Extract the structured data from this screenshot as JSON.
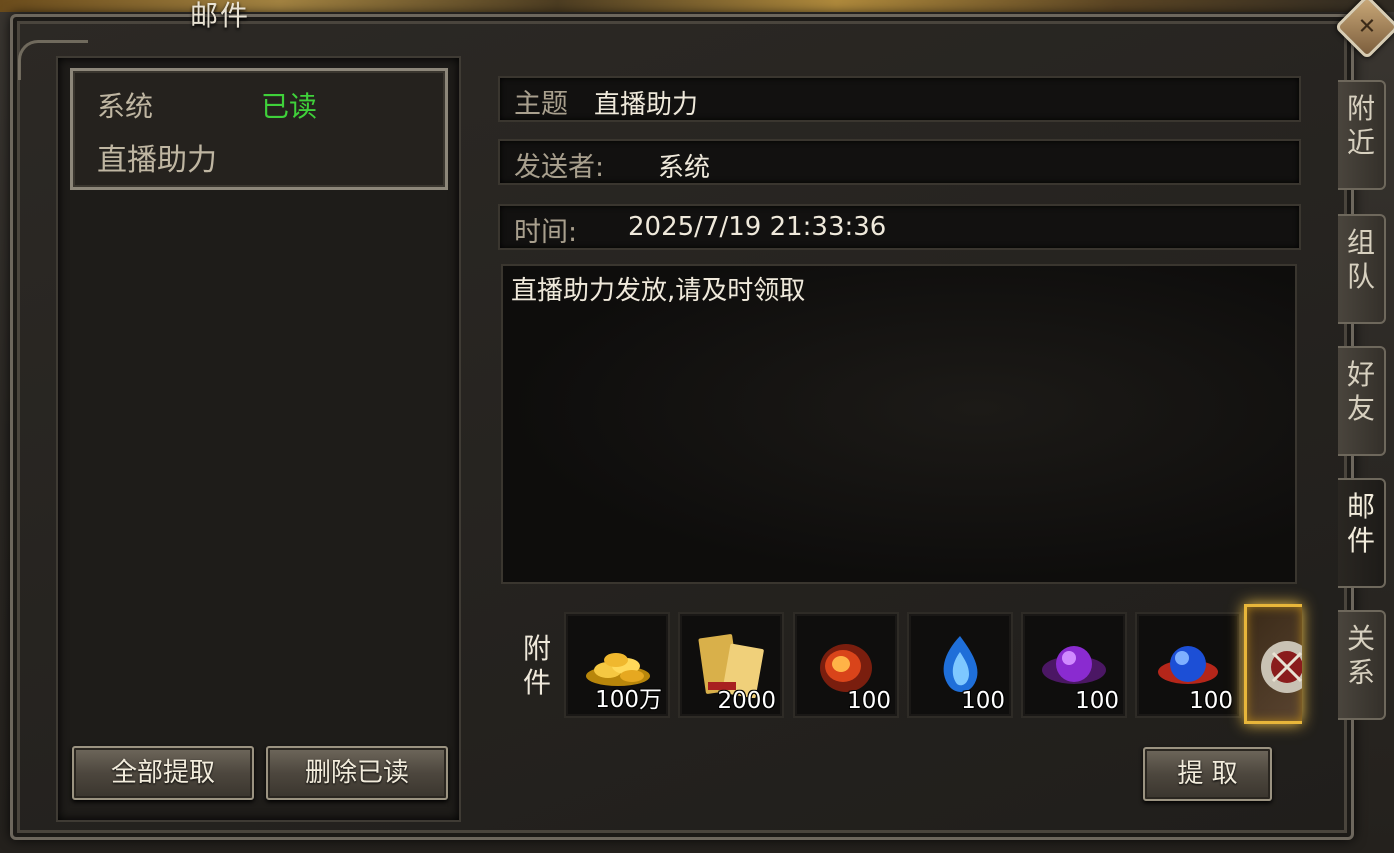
{
  "window": {
    "title": "邮件",
    "close_symbol": "✕"
  },
  "mail_list": [
    {
      "sender": "系统",
      "status": "已读",
      "subject": "直播助力"
    }
  ],
  "left_buttons": {
    "claim_all": "全部提取",
    "delete_read": "删除已读"
  },
  "detail": {
    "subject_label": "主题",
    "subject": "直播助力",
    "sender_label": "发送者:",
    "sender": "系统",
    "time_label": "时间:",
    "time": "2025/7/19 21:33:36",
    "body": "直播助力发放,请及时领取"
  },
  "attachments": {
    "label": "附件",
    "items": [
      {
        "icon": "gold-coins-icon",
        "qty": "100万"
      },
      {
        "icon": "gold-ticket-icon",
        "qty": "2000"
      },
      {
        "icon": "red-fire-stone-icon",
        "qty": "100"
      },
      {
        "icon": "blue-flame-icon",
        "qty": "100"
      },
      {
        "icon": "purple-orb-icon",
        "qty": "100"
      },
      {
        "icon": "blue-red-orb-icon",
        "qty": "100"
      }
    ]
  },
  "claim_button": "提 取",
  "tabs": [
    {
      "label": "附近"
    },
    {
      "label": "组队"
    },
    {
      "label": "好友"
    },
    {
      "label": "邮件",
      "active": true
    },
    {
      "label": "关系"
    }
  ],
  "colors": {
    "read_status": "#3fd13a",
    "accent_gold": "#e8b63a"
  }
}
